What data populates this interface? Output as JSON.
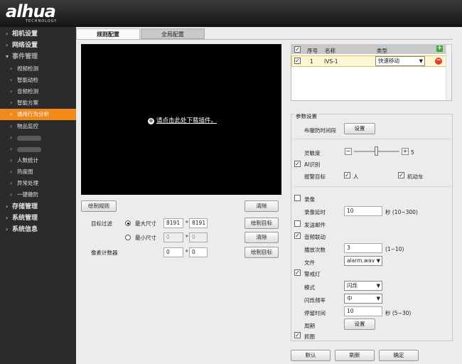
{
  "brand": {
    "logo": "alhua",
    "sub": "TECHNOLOGY"
  },
  "nav": [
    {
      "label": "相机设置",
      "level": "top"
    },
    {
      "label": "网络设置",
      "level": "top"
    },
    {
      "label": "事件管理",
      "level": "top-open"
    },
    {
      "label": "视频检测",
      "level": "sub"
    },
    {
      "label": "智能动检",
      "level": "sub"
    },
    {
      "label": "音频检测",
      "level": "sub"
    },
    {
      "label": "智能方案",
      "level": "sub"
    },
    {
      "label": "通用行为分析",
      "level": "sub",
      "active": true
    },
    {
      "label": "物品监控",
      "level": "sub"
    },
    {
      "label": "",
      "level": "sub-blur"
    },
    {
      "label": "",
      "level": "sub-blur"
    },
    {
      "label": "人数统计",
      "level": "sub"
    },
    {
      "label": "热度图",
      "level": "sub"
    },
    {
      "label": "异常处理",
      "level": "sub"
    },
    {
      "label": "一键撤防",
      "level": "sub"
    },
    {
      "label": "存储管理",
      "level": "top"
    },
    {
      "label": "系统管理",
      "level": "top"
    },
    {
      "label": "系统信息",
      "level": "top"
    }
  ],
  "tabs": {
    "rule": "规则配置",
    "global": "全局配置"
  },
  "video": {
    "plugin_text": "请点击此处下载插件。"
  },
  "left": {
    "draw_rule": "绘制规则",
    "clear": "清除",
    "target_filter": "目标过滤",
    "max_size": "最大尺寸",
    "min_size": "最小尺寸",
    "max_w": "8191",
    "max_h": "8191",
    "min_w": "0",
    "min_h": "0",
    "x": "*",
    "draw_target": "绘制目标",
    "clear2": "清除",
    "pixel_counter": "像素计数器",
    "pix_w": "0",
    "pix_h": "0",
    "draw_target2": "绘制目标"
  },
  "table": {
    "headers": {
      "no": "序号",
      "name": "名称",
      "type": "类型"
    },
    "rows": [
      {
        "no": "1",
        "name": "IVS-1",
        "type": "快速移动"
      }
    ]
  },
  "params": {
    "title": "参数设置",
    "schedule": "布撤防时间段",
    "setup": "设置",
    "sensitivity": "灵敏度",
    "sens_value": "5",
    "sens_level": 0.5,
    "ai": "AI识别",
    "alarm_target": "报警目标",
    "human": "人",
    "vehicle": "机动车",
    "record": "录像",
    "record_delay": "录像延时",
    "record_delay_val": "10",
    "record_range": "秒 (10~300)",
    "email": "发送邮件",
    "audio": "音频联动",
    "play_count": "播放次数",
    "play_count_val": "3",
    "play_range": "(1~10)",
    "file": "文件",
    "file_val": "alarm.wav",
    "warn_light": "警戒灯",
    "mode": "模式",
    "mode_val": "闪烁",
    "flash_freq": "闪烁频率",
    "freq_val": "中",
    "stay_time": "停留时间",
    "stay_val": "10",
    "stay_range": "秒 (5~30)",
    "period": "周期",
    "period_btn": "设置",
    "snapshot": "抓图"
  },
  "footer": {
    "default": "默认",
    "refresh": "刷新",
    "ok": "确定"
  },
  "colors": {
    "active": "#f08a1a",
    "add": "#3fa535",
    "remove": "#e0402a"
  }
}
